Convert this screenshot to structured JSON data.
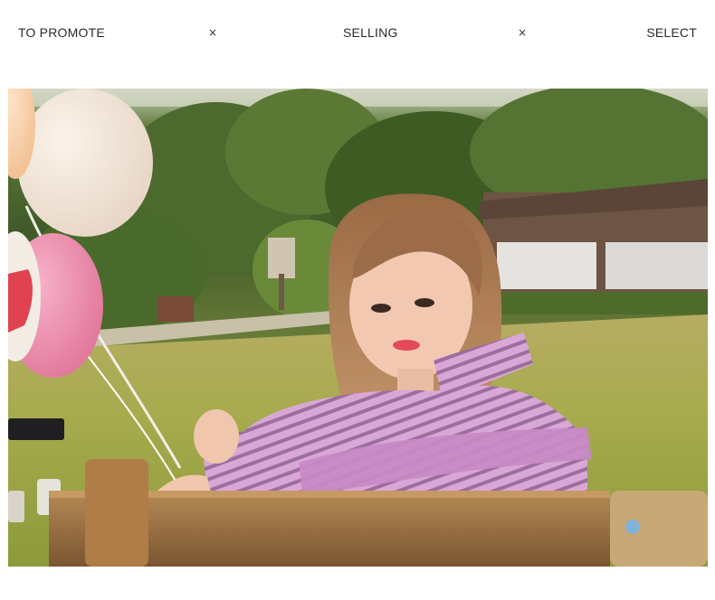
{
  "nav": {
    "items": [
      "TO PROMOTE",
      "SELLING",
      "SELECT"
    ],
    "separator": "×"
  },
  "photo": {
    "subject": "woman-on-bench-with-balloons"
  },
  "colors": {
    "text": "#2b2b2b",
    "background": "#ffffff",
    "shirt": "#c98fc3",
    "grass": "#a3a94c"
  }
}
